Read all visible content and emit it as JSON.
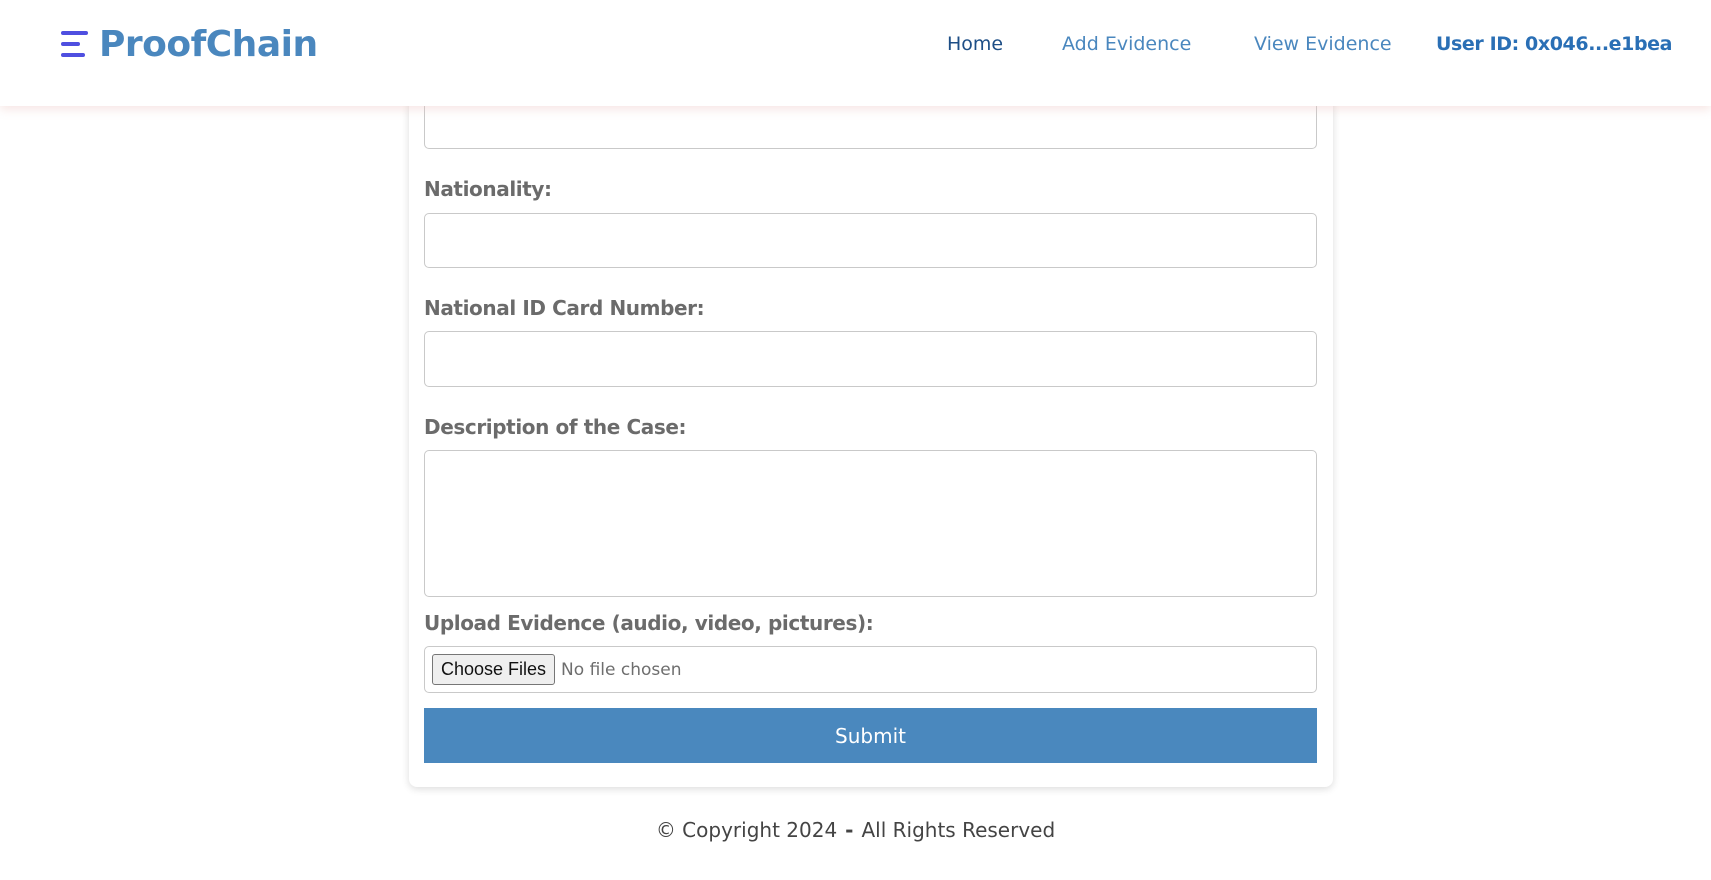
{
  "header": {
    "logo_text": "ProofChain",
    "logo_icon": "menu-lines-icon",
    "nav": {
      "home": "Home",
      "add_evidence": "Add Evidence",
      "view_evidence": "View Evidence"
    },
    "user_id": "User ID: 0x046...e1bea"
  },
  "form": {
    "fields": [
      {
        "label": "",
        "value": ""
      },
      {
        "label": "Nationality:",
        "value": ""
      },
      {
        "label": "National ID Card Number:",
        "value": ""
      },
      {
        "label": "Description of the Case:",
        "value": ""
      }
    ],
    "upload": {
      "label": "Upload Evidence (audio, video, pictures):",
      "button": "Choose Files",
      "status": "No file chosen"
    },
    "submit": "Submit"
  },
  "footer": {
    "copyright": "© Copyright 2024",
    "separator": "-",
    "rights": "All Rights Reserved"
  },
  "colors": {
    "brand": "#4a87be",
    "logo_icon": "#4f4fe0",
    "submit_bg": "#4a88be"
  }
}
